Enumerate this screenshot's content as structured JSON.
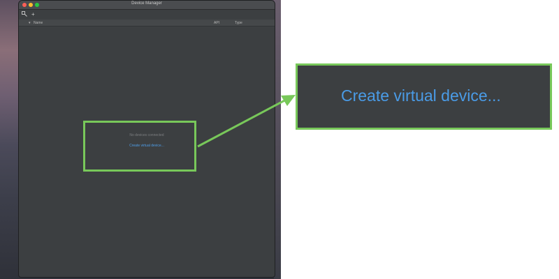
{
  "window": {
    "title": "Device Manager",
    "toolbar": {
      "icons": [
        "device-list-icon",
        "add-icon"
      ],
      "add_label": "+"
    },
    "columns": [
      {
        "label": "Name",
        "sort": "descending"
      },
      {
        "label": "API"
      },
      {
        "label": "Type"
      }
    ],
    "empty_state": {
      "message": "No devices connected",
      "link": "Create virtual device..."
    }
  },
  "callout": {
    "link": "Create virtual device..."
  },
  "colors": {
    "highlight": "#78c85a",
    "link": "#4a9be6",
    "panel": "#3c3f41"
  }
}
